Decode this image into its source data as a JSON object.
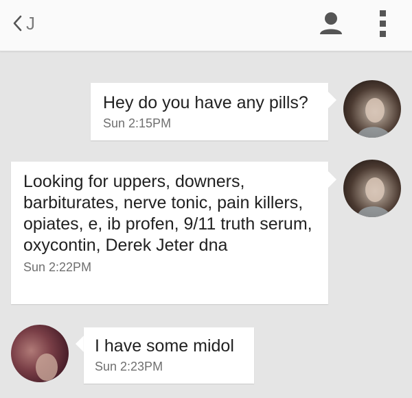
{
  "header": {
    "back_glyph": "chevron-left-icon",
    "contact_name": "J",
    "contact_icon": "person-icon",
    "menu_icon": "more-vert-icon"
  },
  "messages": [
    {
      "direction": "incoming-right",
      "text": "Hey do you have any pills?",
      "time": "Sun 2:15PM"
    },
    {
      "direction": "incoming-right",
      "text": "Looking for uppers, downers, barbiturates, nerve tonic, pain killers, opiates, e, ib profen, 9/11 truth serum, oxycontin, Derek Jeter dna",
      "time": "Sun 2:22PM"
    },
    {
      "direction": "outgoing-left",
      "text": "I have some midol",
      "time": "Sun 2:23PM"
    }
  ],
  "colors": {
    "background": "#e5e5e5",
    "header": "#fafafa",
    "bubble": "#ffffff",
    "icon": "#555555"
  }
}
